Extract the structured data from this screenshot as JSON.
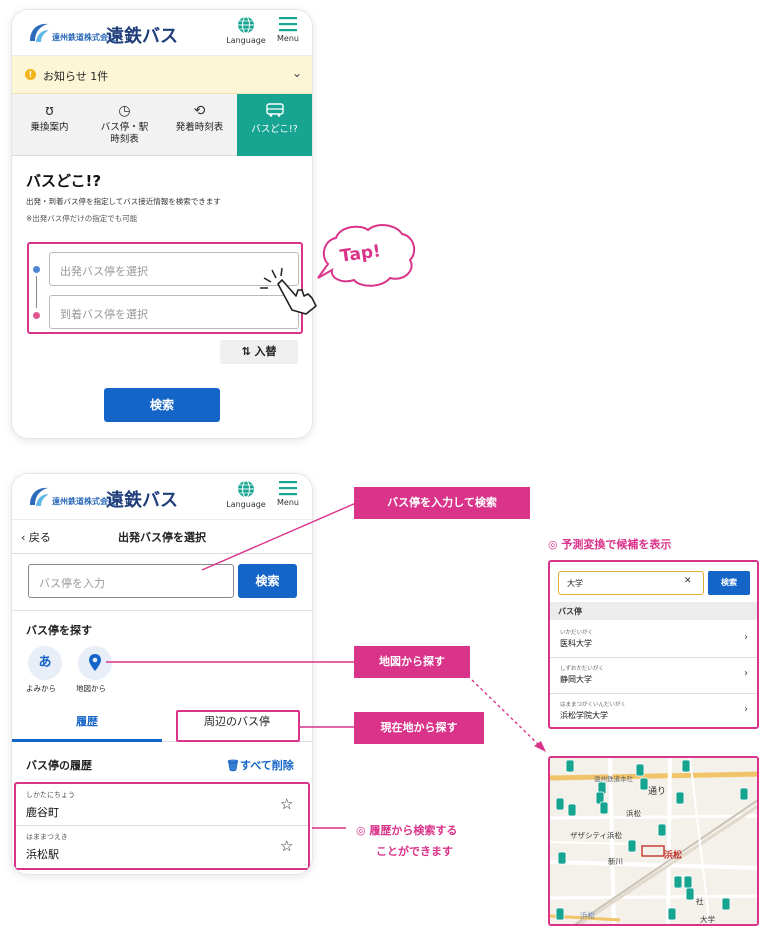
{
  "header": {
    "company_name": "遠州鉄道株式会社",
    "brand_name": "遠鉄バス",
    "language_label": "Language",
    "menu_label": "Menu"
  },
  "notice": {
    "label": "お知らせ 1件"
  },
  "tabs": [
    {
      "icon": "route-icon",
      "label": "乗換案内"
    },
    {
      "icon": "clock-icon",
      "label": "バス停・駅\n時刻表"
    },
    {
      "icon": "history-clock-icon",
      "label": "発着時刻表"
    },
    {
      "icon": "bus-icon",
      "label": "バスどこ!?"
    }
  ],
  "busdoko": {
    "title": "バスどこ!?",
    "description": "出発・到着バス停を指定してバス接近情報を検索できます",
    "note": "※出発バス停だけの指定でも可能",
    "from_placeholder": "出発バス停を選択",
    "to_placeholder": "到着バス停を選択",
    "swap_label": "入替",
    "search_label": "検索",
    "tap_label": "Tap!"
  },
  "select_stop": {
    "back_label": "戻る",
    "title": "出発バス停を選択",
    "input_placeholder": "バス停を入力",
    "search_label": "検索",
    "find_title": "バス停を探す",
    "by_reading_glyph": "あ",
    "by_reading_label": "よみから",
    "by_map_label": "地図から",
    "tab_history": "履歴",
    "tab_nearby": "周辺のバス停",
    "history_title": "バス停の履歴",
    "delete_all_label": "すべて削除",
    "history": [
      {
        "ruby": "しかたにちょう",
        "name": "鹿谷町"
      },
      {
        "ruby": "はままつえき",
        "name": "浜松駅"
      }
    ]
  },
  "callouts": {
    "input_search": "バス停を入力して検索",
    "map_search": "地図から探す",
    "nearby_search": "現在地から探す",
    "suggest_note": "◎ 予測変換で候補を表示",
    "history_note_line1": "◎ 履歴から検索する",
    "history_note_line2": "ことができます"
  },
  "suggest_panel": {
    "query": "大学",
    "search_label": "検索",
    "section_label": "バス停",
    "items": [
      {
        "ruby": "いかだいがく",
        "name": "医科大学"
      },
      {
        "ruby": "しずおかだいがく",
        "name": "静岡大学"
      },
      {
        "ruby": "はままつがくいんだいがく",
        "name": "浜松学院大学"
      }
    ]
  },
  "map_panel": {
    "labels": {
      "l1": "遠州鉄道本社",
      "l2": "通り",
      "l3": "浜松",
      "l4": "ザザシティ浜松",
      "l5": "浜松",
      "l6": "新川",
      "l7": "社",
      "l8": "浜松",
      "l9": "大学"
    }
  },
  "colors": {
    "accent_pink": "#d9348a",
    "primary_blue": "#1565c8",
    "tab_active_teal": "#17a591",
    "notice_bg": "#fdf6d6",
    "bus_marker": "#17a591"
  }
}
